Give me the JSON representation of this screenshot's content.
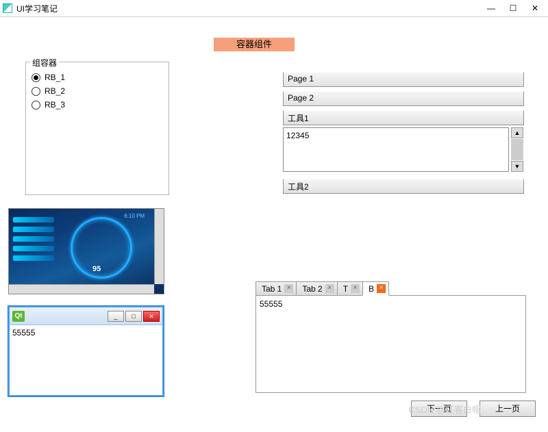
{
  "window": {
    "title": "UI学习笔记"
  },
  "header": {
    "banner": "容器组件"
  },
  "groupbox": {
    "title": "组容器",
    "radios": [
      "RB_1",
      "RB_2",
      "RB_3"
    ],
    "selected": 0
  },
  "stack": {
    "pages": [
      "Page 1",
      "Page 2"
    ],
    "tools": [
      "工具1",
      "工具2"
    ],
    "text_content": "12345"
  },
  "mdi": {
    "gauge_value": "95",
    "time": "6:10 PM"
  },
  "qt_sub": {
    "logo": "Qt",
    "content": "55555"
  },
  "tabs": {
    "items": [
      {
        "label": "Tab 1",
        "closable": true
      },
      {
        "label": "Tab 2",
        "closable": true
      },
      {
        "label": "T",
        "closable": true
      },
      {
        "label": "B",
        "closable": true,
        "active_close": true
      }
    ],
    "active": 3,
    "content": "55555"
  },
  "buttons": {
    "prev": "下一页",
    "next": "上一页"
  },
  "watermark": "CSDN @红客白帽"
}
